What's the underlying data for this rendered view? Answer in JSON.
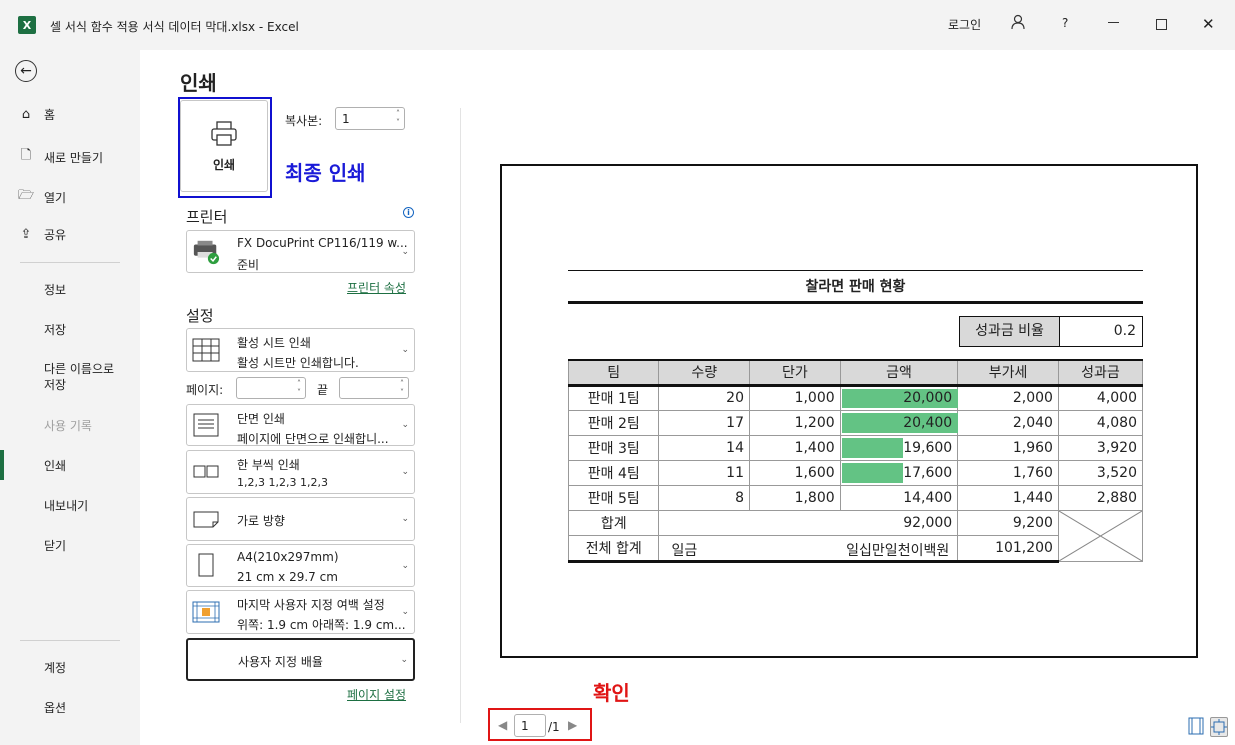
{
  "window": {
    "title": "셀 서식 함수 적용 서식 데이터 막대.xlsx  -  Excel",
    "login": "로그인",
    "help": "?"
  },
  "sidebar": {
    "home": "홈",
    "new": "새로 만들기",
    "open": "열기",
    "share": "공유",
    "info": "정보",
    "save": "저장",
    "save_as": "다른 이름으로 저장",
    "history": "사용 기록",
    "print": "인쇄",
    "export": "내보내기",
    "close": "닫기",
    "account": "계정",
    "options": "옵션"
  },
  "print": {
    "heading": "인쇄",
    "button_label": "인쇄",
    "annotation_final": "최종 인쇄",
    "copies_label": "복사본:",
    "copies_value": "1",
    "printer_section": "프린터",
    "printer_name": "FX DocuPrint CP116/119 w...",
    "printer_status": "준비",
    "printer_props": "프린터 속성",
    "settings_section": "설정",
    "active_sheet_title": "활성 시트 인쇄",
    "active_sheet_desc": "활성 시트만 인쇄합니다.",
    "pages_label": "페이지:",
    "to_label": "끝",
    "one_side_title": "단면 인쇄",
    "one_side_desc": "페이지에 단면으로 인쇄합니...",
    "collate_title": "한 부씩 인쇄",
    "collate_desc": "1,2,3    1,2,3    1,2,3",
    "orientation": "가로 방향",
    "paper_title": "A4(210x297mm)",
    "paper_desc": "21 cm x 29.7 cm",
    "margin_title": "마지막 사용자 지정 여백 설정",
    "margin_desc": "위쪽: 1.9 cm 아래쪽: 1.9 cm...",
    "scaling": "사용자 지정 배율",
    "page_setup": "페이지 설정"
  },
  "sheet": {
    "title": "찰라면 판매 현황",
    "bonus_label": "성과금 비율",
    "bonus_value": "0.2",
    "headers": [
      "팀",
      "수량",
      "단가",
      "금액",
      "부가세",
      "성과금"
    ],
    "rows": [
      [
        "판매 1팀",
        "20",
        "1,000",
        "20,000",
        "2,000",
        "4,000"
      ],
      [
        "판매 2팀",
        "17",
        "1,200",
        "20,400",
        "2,040",
        "4,080"
      ],
      [
        "판매 3팀",
        "14",
        "1,400",
        "19,600",
        "1,960",
        "3,920"
      ],
      [
        "판매 4팀",
        "11",
        "1,600",
        "17,600",
        "1,760",
        "3,520"
      ],
      [
        "판매 5팀",
        "8",
        "1,800",
        "14,400",
        "1,440",
        "2,880"
      ]
    ],
    "data_bars": [
      1.0,
      1.0,
      0.53,
      0.53,
      0.0
    ],
    "data_bar_color": "#63c384",
    "total_label": "합계",
    "total_amount": "92,000",
    "total_vat": "9,200",
    "grand_label": "전체 합계",
    "grand_prefix": "일금",
    "grand_words": "일십만일천이백원",
    "grand_value": "101,200"
  },
  "preview_nav": {
    "annotation_confirm": "확인",
    "current_page": "1",
    "total_pages": "/1"
  }
}
